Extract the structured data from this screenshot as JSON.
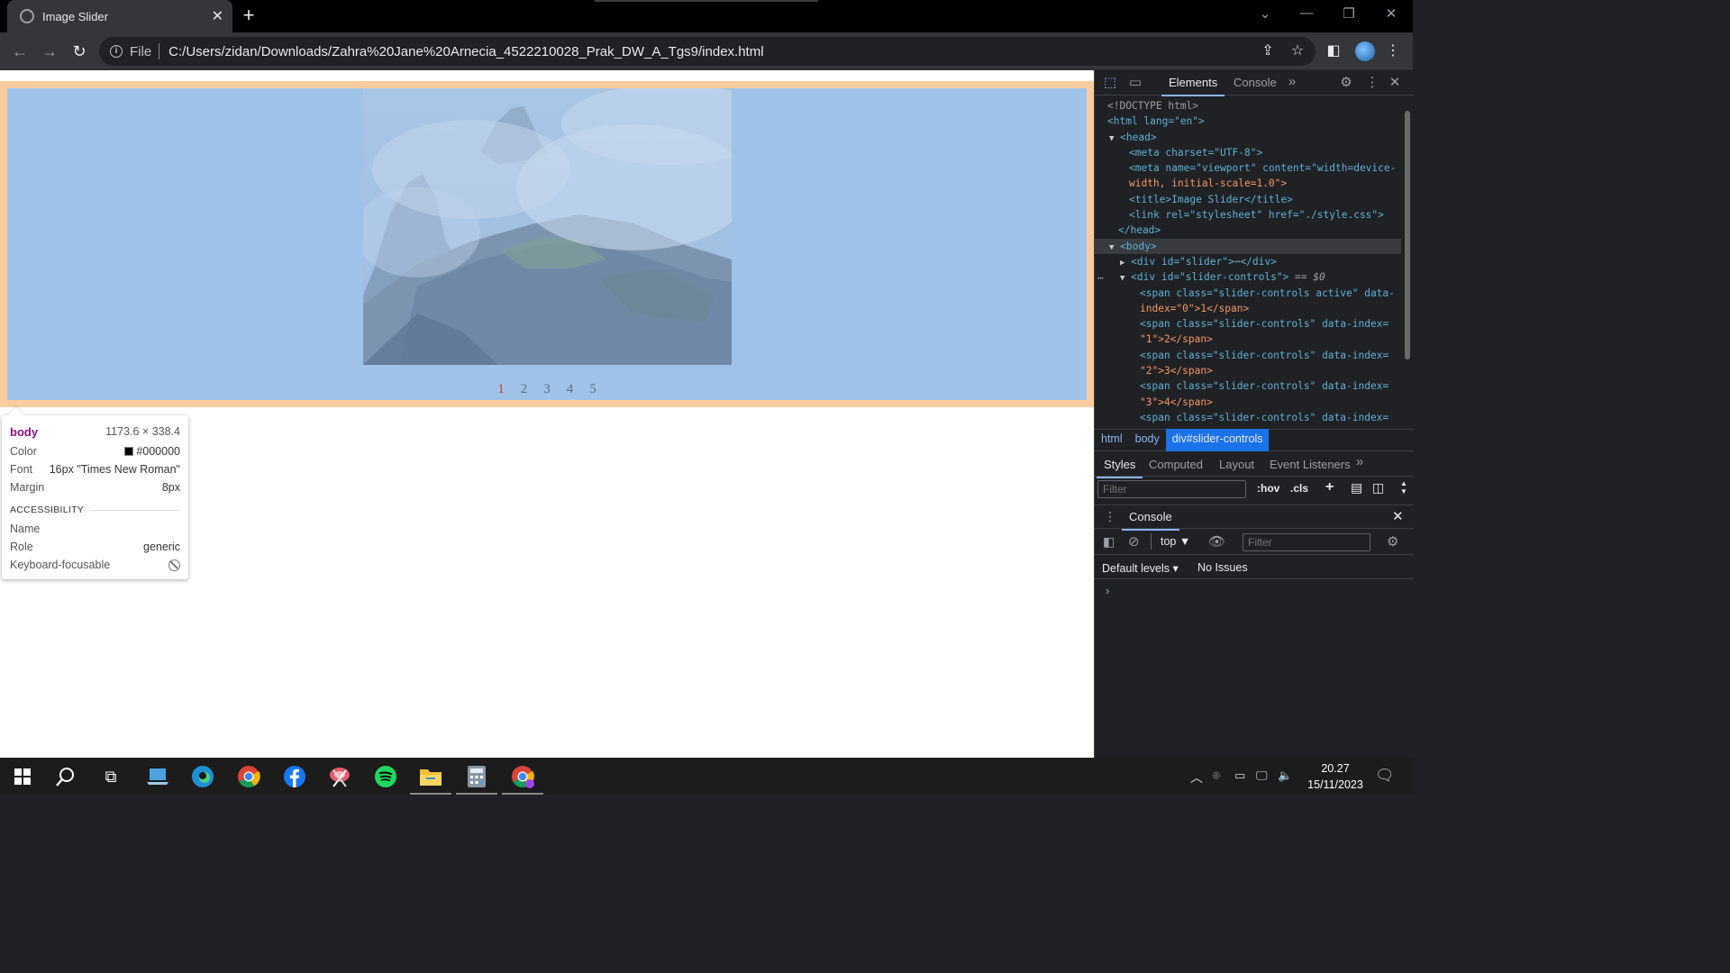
{
  "tab": {
    "title": "Image Slider"
  },
  "omnibox": {
    "scheme_label": "File",
    "url": "C:/Users/zidan/Downloads/Zahra%20Jane%20Arnecia_4522210028_Prak_DW_A_Tgs9/index.html"
  },
  "page": {
    "slider_controls": [
      {
        "label": "1",
        "active": true
      },
      {
        "label": "2",
        "active": false
      },
      {
        "label": "3",
        "active": false
      },
      {
        "label": "4",
        "active": false
      },
      {
        "label": "5",
        "active": false
      }
    ]
  },
  "inspect_tooltip": {
    "tag": "body",
    "size": "1173.6 × 338.4",
    "rows": [
      {
        "key": "Color",
        "value": "#000000"
      },
      {
        "key": "Font",
        "value": "16px \"Times New Roman\""
      },
      {
        "key": "Margin",
        "value": "8px"
      }
    ],
    "accessibility_title": "ACCESSIBILITY",
    "acc_rows": [
      {
        "key": "Name",
        "value": ""
      },
      {
        "key": "Role",
        "value": "generic"
      },
      {
        "key": "Keyboard-focusable",
        "value": ""
      }
    ]
  },
  "devtools": {
    "tabs": [
      "Elements",
      "Console"
    ],
    "selected_tab": "Elements",
    "dom_lines": [
      "<!DOCTYPE html>",
      "<html lang=\"en\">",
      "<head>",
      "<meta charset=\"UTF-8\">",
      "<meta name=\"viewport\" content=\"width=device-",
      "width, initial-scale=1.0\">",
      "<title>Image Slider</title>",
      "<link rel=\"stylesheet\" href=\"./style.css\">",
      "</head>",
      "<body>",
      "<div id=\"slider\">",
      "</div>",
      "<div id=\"slider-controls\">",
      "== $0",
      "<span class=\"slider-controls active\" data-",
      "index=\"0\">1</span>",
      "<span class=\"slider-controls\" data-index=",
      "\"1\">2</span>",
      "<span class=\"slider-controls\" data-index=",
      "\"2\">3</span>",
      "<span class=\"slider-controls\" data-index=",
      "\"3\">4</span>",
      "<span class=\"slider-controls\" data-index="
    ],
    "breadcrumbs": [
      "html",
      "body",
      "div#slider-controls"
    ],
    "style_tabs": [
      "Styles",
      "Computed",
      "Layout",
      "Event Listeners"
    ],
    "styles_filter_placeholder": "Filter",
    "hov_label": ":hov",
    "cls_label": ".cls",
    "console": {
      "title": "Console",
      "context": "top",
      "filter_placeholder": "Filter",
      "levels": "Default levels",
      "issues": "No Issues"
    }
  },
  "taskbar": {
    "time": "20.27",
    "date": "15/11/2023"
  },
  "colors": {
    "slider_bg": "#9fc3e8",
    "margin_highlight": "#f9cc9d",
    "active_control": "#c0392b",
    "devtools_accent": "#8ab4f8"
  }
}
